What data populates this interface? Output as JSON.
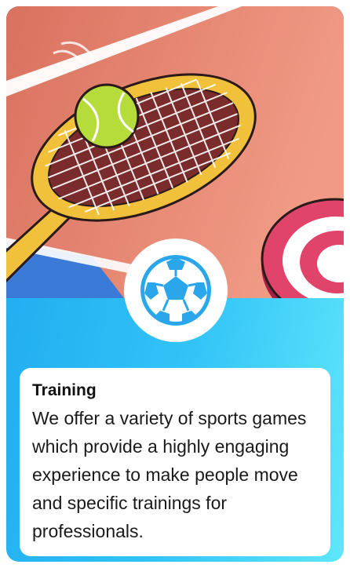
{
  "card": {
    "title": "Training",
    "description": "We offer a variety of sports games which provide a highly engaging experience to make people move and specific trainings for professionals.",
    "hero_image": "tennis-court-illustration",
    "badge_icon": "soccer-ball-icon"
  },
  "colors": {
    "court": "#e07e6a",
    "court_light": "#ee9a86",
    "court_blue": "#3c7ad8",
    "card_gradient_start": "#1ea8ef",
    "card_gradient_end": "#5fe6fb",
    "racket": "#f2c13c",
    "ball": "#b6dc3c",
    "target_red": "#e0446a",
    "soccer_ball": "#2aa7ea"
  }
}
